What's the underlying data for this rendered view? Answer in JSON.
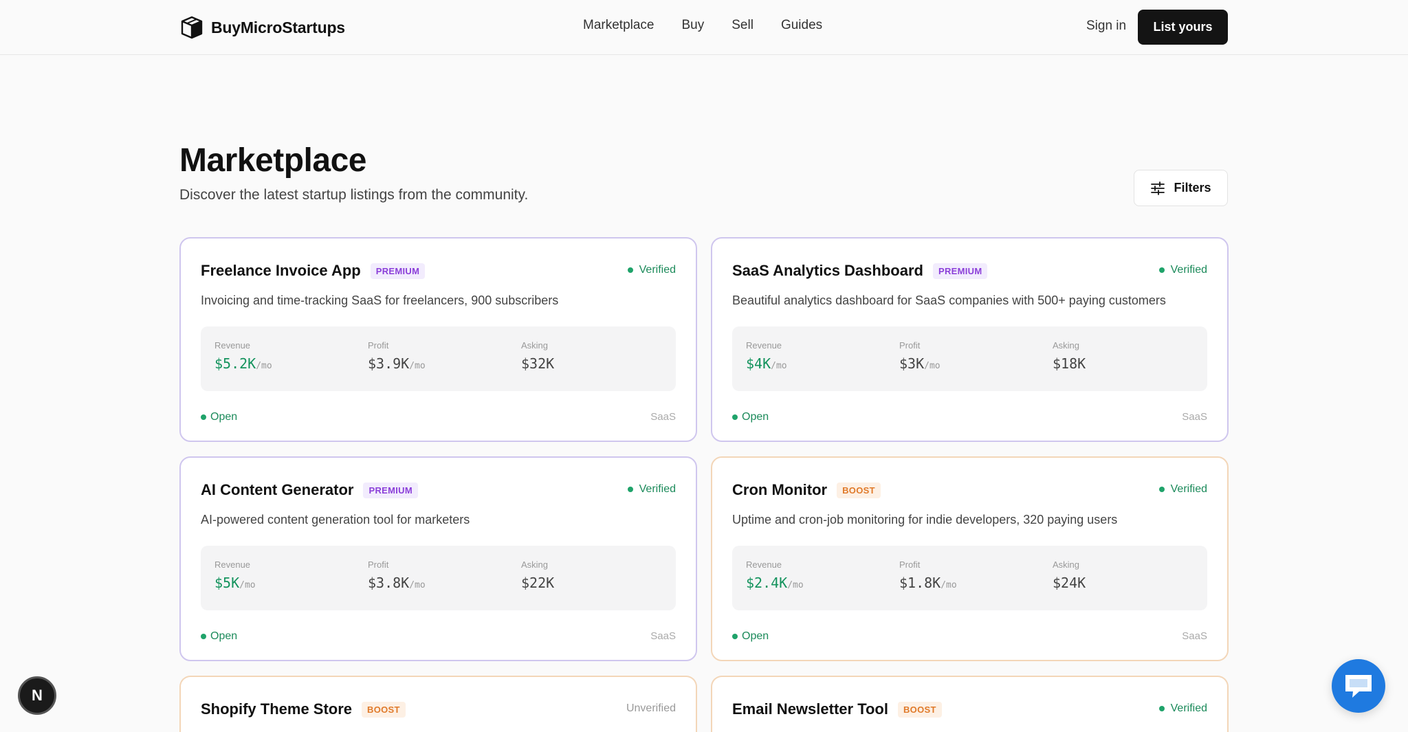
{
  "brand": {
    "name": "BuyMicroStartups",
    "icon": "box-logo-icon"
  },
  "nav": {
    "items": [
      "Marketplace",
      "Buy",
      "Sell",
      "Guides"
    ]
  },
  "auth": {
    "signin_label": "Sign in",
    "list_label": "List yours"
  },
  "page": {
    "title": "Marketplace",
    "subtitle": "Discover the latest startup listings from the community.",
    "filters_label": "Filters"
  },
  "labels": {
    "revenue": "Revenue",
    "profit": "Profit",
    "asking": "Asking",
    "per_month": "/mo"
  },
  "listings": [
    {
      "title": "Freelance Invoice App",
      "tag": "PREMIUM",
      "verification": "Verified",
      "description": "Invoicing and time-tracking SaaS for freelancers, 900 subscribers",
      "revenue": "$5.2K",
      "profit": "$3.9K",
      "asking": "$32K",
      "status": "Open",
      "category": "SaaS"
    },
    {
      "title": "SaaS Analytics Dashboard",
      "tag": "PREMIUM",
      "verification": "Verified",
      "description": "Beautiful analytics dashboard for SaaS companies with 500+ paying customers",
      "revenue": "$4K",
      "profit": "$3K",
      "asking": "$18K",
      "status": "Open",
      "category": "SaaS"
    },
    {
      "title": "AI Content Generator",
      "tag": "PREMIUM",
      "verification": "Verified",
      "description": "AI-powered content generation tool for marketers",
      "revenue": "$5K",
      "profit": "$3.8K",
      "asking": "$22K",
      "status": "Open",
      "category": "SaaS"
    },
    {
      "title": "Cron Monitor",
      "tag": "BOOST",
      "verification": "Verified",
      "description": "Uptime and cron-job monitoring for indie developers, 320 paying users",
      "revenue": "$2.4K",
      "profit": "$1.8K",
      "asking": "$24K",
      "status": "Open",
      "category": "SaaS"
    },
    {
      "title": "Shopify Theme Store",
      "tag": "BOOST",
      "verification": "Unverified"
    },
    {
      "title": "Email Newsletter Tool",
      "tag": "BOOST",
      "verification": "Verified"
    }
  ],
  "floating": {
    "badge_letter": "N",
    "chat_icon": "chat-bubble-icon"
  },
  "colors": {
    "accent_green": "#14935d",
    "premium": "#8b3fd9",
    "boost": "#e07a2a",
    "primary_button": "#141414",
    "chat": "#1f7ae0"
  }
}
